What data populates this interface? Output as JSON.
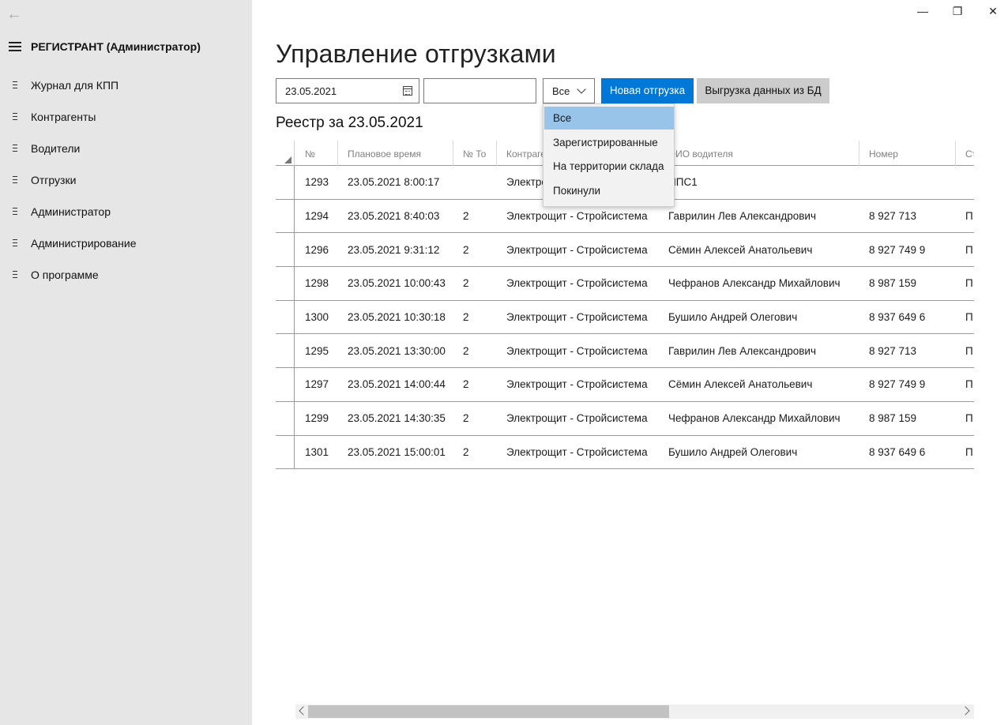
{
  "sidebar": {
    "title": "РЕГИСТРАНТ (Администратор)",
    "items": [
      {
        "label": "Журнал для КПП"
      },
      {
        "label": "Контрагенты"
      },
      {
        "label": "Водители"
      },
      {
        "label": "Отгрузки"
      },
      {
        "label": "Администратор"
      },
      {
        "label": "Администрирование"
      },
      {
        "label": "О программе"
      }
    ]
  },
  "window_controls": {
    "minimize": "—",
    "restore": "❐",
    "close": "✕"
  },
  "page": {
    "title": "Управление отгрузками",
    "section_title": "Реестр за 23.05.2021"
  },
  "toolbar": {
    "date_value": "23.05.2021",
    "search_value": "",
    "filter_value": "Все",
    "new_shipment_label": "Новая отгрузка",
    "export_label": "Выгрузка данных из БД"
  },
  "dropdown": {
    "options": [
      "Все",
      "Зарегистрированные",
      "На территории склада",
      "Покинули"
    ],
    "selected_index": 0
  },
  "table": {
    "columns": [
      "№",
      "Плановое время",
      "№ То",
      "Контрагент",
      "ФИО водителя",
      "Номер",
      "Статус"
    ],
    "rows": [
      [
        "1293",
        "23.05.2021 8:00:17",
        "",
        "Электрощит - Стройсистема",
        "НПС1",
        "",
        ""
      ],
      [
        "1294",
        "23.05.2021 8:40:03",
        "2",
        "Электрощит - Стройсистема",
        "Гаврилин Лев  Александрович",
        "8 927 713",
        "П"
      ],
      [
        "1296",
        "23.05.2021 9:31:12",
        "2",
        "Электрощит - Стройсистема",
        "Сёмин Алексей Анатольевич",
        "8 927 749 9",
        "П"
      ],
      [
        "1298",
        "23.05.2021 10:00:43",
        "2",
        "Электрощит - Стройсистема",
        "Чефранов  Александр Михайлович",
        "8 987 159",
        "П"
      ],
      [
        "1300",
        "23.05.2021 10:30:18",
        "2",
        "Электрощит - Стройсистема",
        "Бушило Андрей Олегович",
        "8 937 649 6",
        "П"
      ],
      [
        "1295",
        "23.05.2021 13:30:00",
        "2",
        "Электрощит - Стройсистема",
        "Гаврилин Лев  Александрович",
        "8 927 713",
        "П"
      ],
      [
        "1297",
        "23.05.2021 14:00:44",
        "2",
        "Электрощит - Стройсистема",
        "Сёмин Алексей Анатольевич",
        "8 927 749 9",
        "П"
      ],
      [
        "1299",
        "23.05.2021 14:30:35",
        "2",
        "Электрощит - Стройсистема",
        "Чефранов  Александр Михайлович",
        "8 987 159",
        "П"
      ],
      [
        "1301",
        "23.05.2021 15:00:01",
        "2",
        "Электрощит - Стройсистема",
        "Бушило Андрей Олегович",
        "8 937 649 6",
        "П"
      ]
    ]
  },
  "colors": {
    "sidebar_bg": "#e6e6e6",
    "accent": "#0078d7",
    "dropdown_selected": "#99c4ea"
  }
}
